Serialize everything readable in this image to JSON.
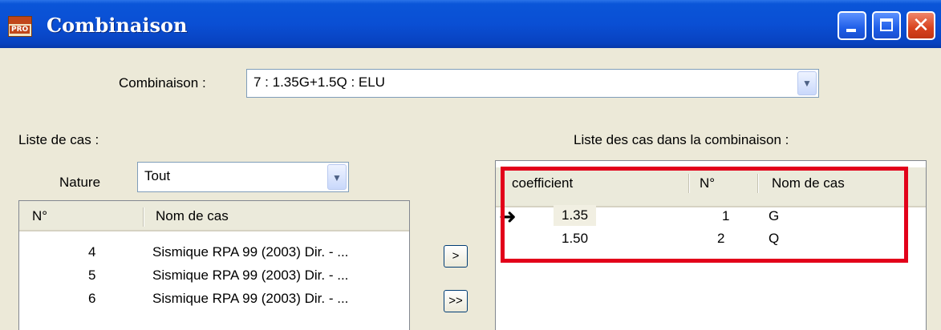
{
  "window": {
    "app_icon_text": "PRO",
    "title": "Combinaison",
    "controls": [
      "minimize",
      "maximize",
      "close"
    ]
  },
  "combination": {
    "label": "Combinaison :",
    "selected": "7 : 1.35G+1.5Q : ELU"
  },
  "case_list": {
    "label": "Liste de cas :",
    "nature_label": "Nature",
    "nature_selected": "Tout",
    "columns": [
      "N°",
      "Nom de cas"
    ],
    "rows": [
      {
        "num": "4",
        "name": "Sismique RPA 99 (2003) Dir. - ..."
      },
      {
        "num": "5",
        "name": "Sismique RPA 99 (2003) Dir. - ..."
      },
      {
        "num": "6",
        "name": "Sismique RPA 99 (2003) Dir. - ..."
      }
    ]
  },
  "transfer_buttons": {
    "add_one": ">",
    "add_all": ">>"
  },
  "combination_cases": {
    "label": "Liste des cas dans la combinaison :",
    "columns": [
      "coefficient",
      "N°",
      "Nom de cas"
    ],
    "current_row_icon": "arrow-right-icon",
    "rows": [
      {
        "coef": "1.35",
        "num": "1",
        "name": "G"
      },
      {
        "coef": "1.50",
        "num": "2",
        "name": "Q"
      }
    ]
  },
  "colors": {
    "titlebar": "#0a4fd4",
    "dialog_bg": "#ece9d8",
    "highlight_box": "#e2001a"
  }
}
